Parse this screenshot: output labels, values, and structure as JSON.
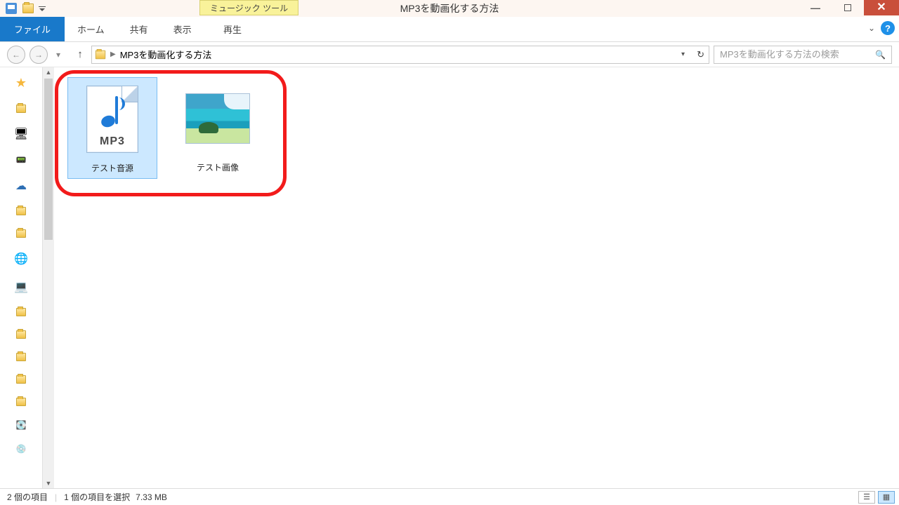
{
  "titlebar": {
    "context_tool_label": "ミュージック ツール",
    "window_title": "MP3を動画化する方法"
  },
  "ribbon": {
    "tabs": {
      "file": "ファイル",
      "home": "ホーム",
      "share": "共有",
      "view": "表示",
      "play": "再生"
    }
  },
  "navbar": {
    "breadcrumb": "MP3を動画化する方法",
    "search_placeholder": "MP3を動画化する方法の検索"
  },
  "content": {
    "items": [
      {
        "label": "テスト音源",
        "type": "mp3",
        "selected": true
      },
      {
        "label": "テスト画像",
        "type": "image",
        "selected": false
      }
    ],
    "mp3_badge": "MP3"
  },
  "statusbar": {
    "count_text": "2 個の項目",
    "selection_text": "1 個の項目を選択",
    "size_text": "7.33 MB"
  }
}
